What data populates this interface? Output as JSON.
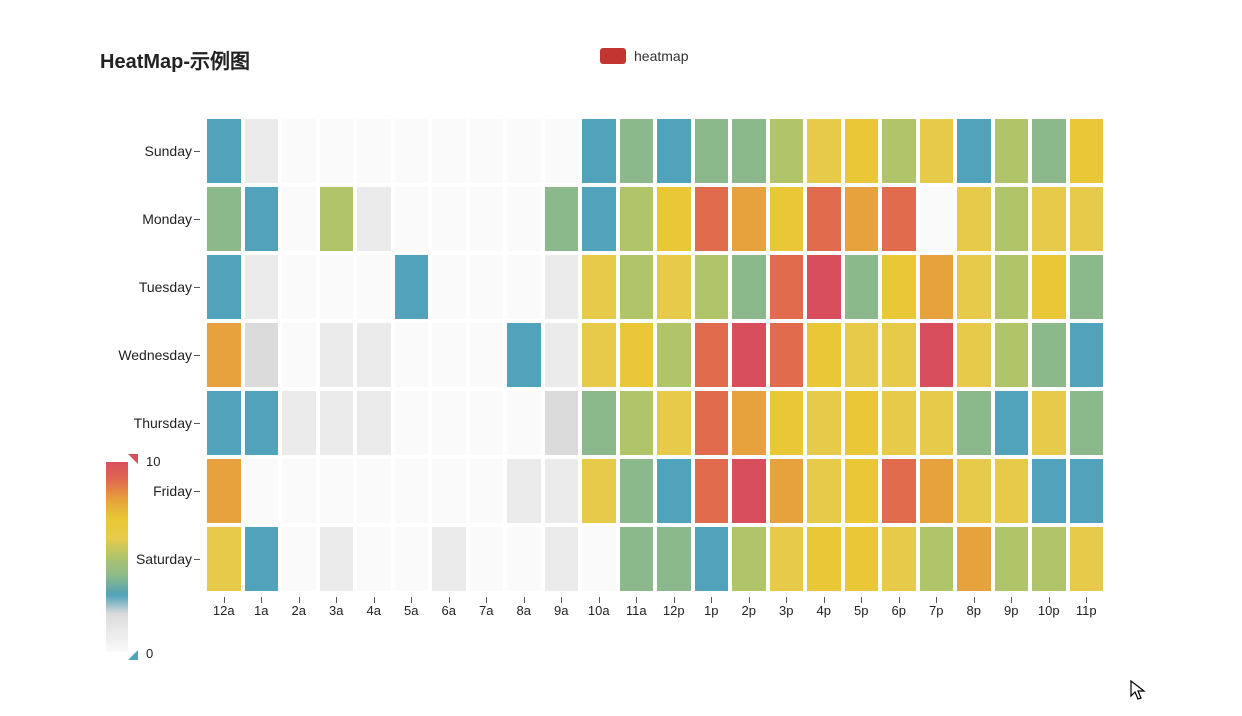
{
  "title": "HeatMap-示例图",
  "legend": {
    "label": "heatmap",
    "color": "#c23531"
  },
  "visualmap": {
    "max_label": "10",
    "min_label": "0"
  },
  "chart_data": {
    "type": "heatmap",
    "title": "HeatMap-示例图",
    "xlabel": "",
    "ylabel": "",
    "zlim": [
      0,
      10
    ],
    "x": [
      "12a",
      "1a",
      "2a",
      "3a",
      "4a",
      "5a",
      "6a",
      "7a",
      "8a",
      "9a",
      "10a",
      "11a",
      "12p",
      "1p",
      "2p",
      "3p",
      "4p",
      "5p",
      "6p",
      "7p",
      "8p",
      "9p",
      "10p",
      "11p"
    ],
    "y": [
      "Sunday",
      "Monday",
      "Tuesday",
      "Wednesday",
      "Thursday",
      "Friday",
      "Saturday"
    ],
    "series": [
      {
        "name": "Sunday",
        "values": [
          3,
          1,
          0,
          0,
          0,
          0,
          0,
          0,
          0,
          0,
          3,
          4,
          3,
          4,
          4,
          5,
          6,
          7,
          5,
          6,
          3,
          5,
          4,
          7
        ]
      },
      {
        "name": "Monday",
        "values": [
          4,
          3,
          0,
          5,
          1,
          0,
          0,
          0,
          0,
          4,
          3,
          5,
          7,
          9,
          8,
          7,
          9,
          8,
          9,
          0,
          6,
          5,
          6,
          6
        ]
      },
      {
        "name": "Tuesday",
        "values": [
          3,
          1,
          0,
          0,
          0,
          3,
          0,
          0,
          0,
          1,
          6,
          5,
          6,
          5,
          4,
          9,
          10,
          4,
          7,
          8,
          6,
          5,
          7,
          4
        ]
      },
      {
        "name": "Wednesday",
        "values": [
          8,
          2,
          0,
          1,
          1,
          0,
          0,
          0,
          3,
          1,
          6,
          7,
          5,
          9,
          10,
          9,
          7,
          6,
          6,
          10,
          6,
          5,
          4,
          3
        ]
      },
      {
        "name": "Thursday",
        "values": [
          3,
          3,
          1,
          1,
          1,
          0,
          0,
          0,
          0,
          2,
          4,
          5,
          6,
          9,
          8,
          7,
          6,
          7,
          6,
          6,
          4,
          3,
          6,
          4
        ]
      },
      {
        "name": "Friday",
        "values": [
          8,
          0,
          0,
          0,
          0,
          0,
          0,
          0,
          1,
          1,
          6,
          4,
          3,
          9,
          10,
          8,
          6,
          7,
          9,
          8,
          6,
          6,
          3,
          3
        ]
      },
      {
        "name": "Saturday",
        "values": [
          6,
          3,
          0,
          1,
          0,
          0,
          1,
          0,
          0,
          1,
          0,
          4,
          4,
          3,
          5,
          6,
          7,
          7,
          6,
          5,
          8,
          5,
          5,
          6
        ]
      }
    ],
    "colorscale": [
      [
        0.0,
        "#fafafa"
      ],
      [
        0.05,
        "#f2f2f2"
      ],
      [
        0.1,
        "#ebebeb"
      ],
      [
        0.2,
        "#dbdbdb"
      ],
      [
        0.3,
        "#50a3ba"
      ],
      [
        0.4,
        "#8bb98b"
      ],
      [
        0.5,
        "#b0c46a"
      ],
      [
        0.6,
        "#e7ca4a"
      ],
      [
        0.7,
        "#eac736"
      ],
      [
        0.8,
        "#e6a23c"
      ],
      [
        0.9,
        "#e06c4d"
      ],
      [
        1.0,
        "#d94e5d"
      ]
    ]
  }
}
